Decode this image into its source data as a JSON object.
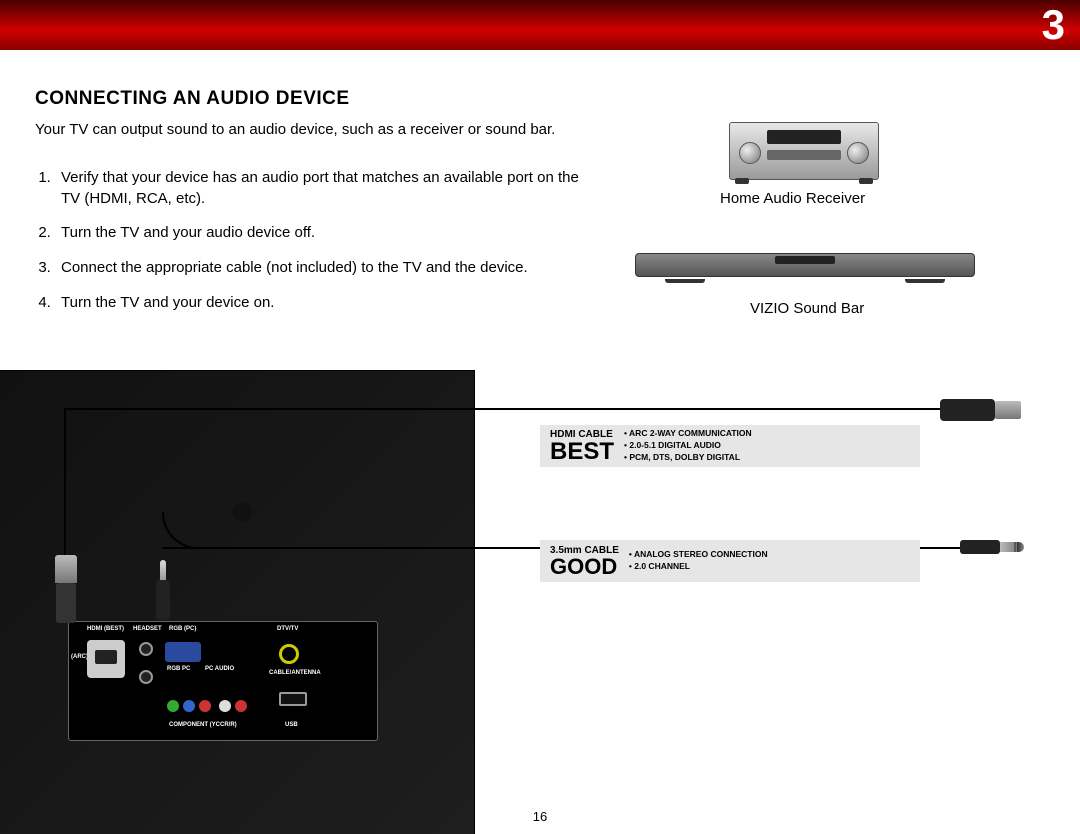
{
  "chapter_number": "3",
  "page_number": "16",
  "heading": "CONNECTING AN AUDIO DEVICE",
  "intro": "Your TV can output sound to an audio device, such as a receiver or sound bar.",
  "steps": [
    "Verify that your device has an audio port that matches an available port on the TV (HDMI, RCA, etc).",
    "Turn the TV and your audio device off.",
    "Connect the appropriate cable (not included) to the TV and the device.",
    "Turn the TV and your device on."
  ],
  "devices": {
    "receiver_label": "Home Audio Receiver",
    "soundbar_label": "VIZIO Sound Bar"
  },
  "cables": {
    "hdmi": {
      "name": "HDMI CABLE",
      "rating": "BEST",
      "features": [
        "ARC 2-WAY COMMUNICATION",
        "2.0-5.1 DIGITAL AUDIO",
        "PCM, DTS, DOLBY DIGITAL"
      ]
    },
    "aux": {
      "name": "3.5mm CABLE",
      "rating": "GOOD",
      "features": [
        "ANALOG STEREO CONNECTION",
        "2.0 CHANNEL"
      ]
    }
  },
  "port_labels": {
    "hdmi": "HDMI (BEST)",
    "arc": "(ARC)",
    "headset": "HEADSET",
    "rgb": "RGB (PC)",
    "dtv": "DTV/TV",
    "rgbpc": "RGB PC",
    "pcaudio": "PC AUDIO",
    "cable": "CABLE/ANTENNA",
    "component": "COMPONENT (YCCR/R)",
    "usb": "USB"
  }
}
